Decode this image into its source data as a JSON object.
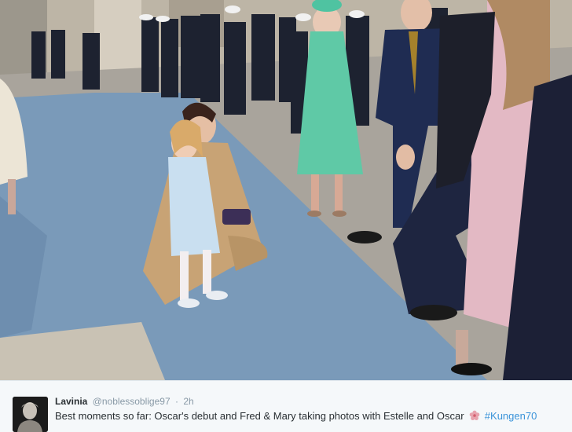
{
  "tweet": {
    "display_name": "Lavinia",
    "handle": "@noblessoblige97",
    "separator": "·",
    "time": "2h",
    "text": "Best moments so far: Oscar's debut and Fred & Mary taking photos with Estelle and Oscar",
    "hashtag": "#Kungen70",
    "emoji_icon": "flower-icon"
  },
  "colors": {
    "link": "#3b94d9",
    "text": "#292f33",
    "muted": "#8899a6",
    "tweet_bg": "#f5f8fa"
  }
}
